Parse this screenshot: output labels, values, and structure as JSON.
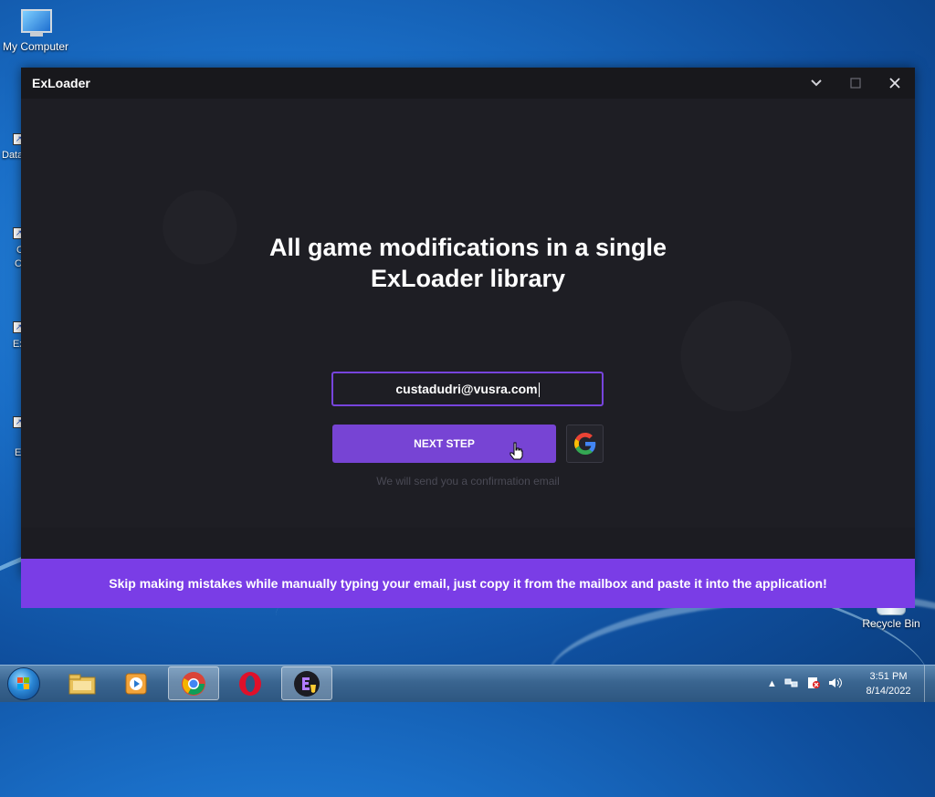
{
  "desktop": {
    "icons": [
      {
        "label": "My Computer"
      },
      {
        "label": "Recycle Bin"
      }
    ],
    "side_labels": [
      "Data",
      "C",
      "C",
      "Ex",
      "E"
    ]
  },
  "app": {
    "title": "ExLoader",
    "headline_line1": "All game modifications in a single",
    "headline_line2": "ExLoader library",
    "email_value": "custadudri@vusra.com",
    "next_button": "NEXT STEP",
    "hint": "We will send you a confirmation email",
    "banner": "Skip making mistakes while manually typing your email, just copy it from the mailbox and paste it into the application!",
    "accent_color": "#7744d4"
  },
  "taskbar": {
    "apps": [
      "windows-explorer",
      "media-player",
      "chrome",
      "opera",
      "exloader"
    ],
    "clock_time": "3:51 PM",
    "clock_date": "8/14/2022"
  }
}
